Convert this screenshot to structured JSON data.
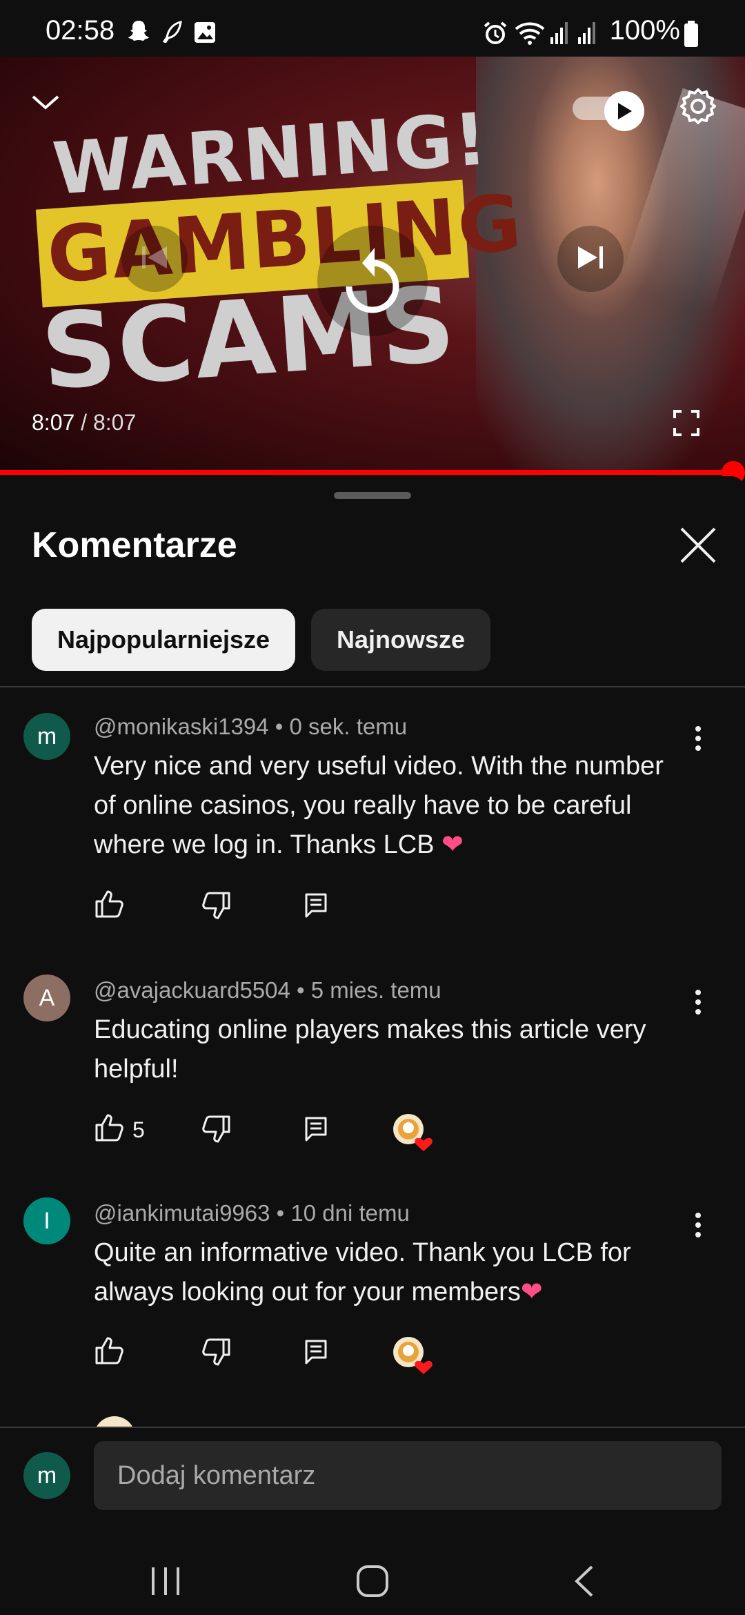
{
  "status_bar": {
    "time": "02:58",
    "battery": "100%",
    "icons": [
      "snapchat-icon",
      "feather-icon",
      "gallery-icon",
      "alarm-icon",
      "wifi-icon",
      "signal-icon",
      "battery-icon"
    ]
  },
  "video": {
    "thumbnail_lines": [
      "WARNING!",
      "GAMBLING",
      "SCAMS"
    ],
    "current_time": "8:07",
    "separator": " / ",
    "duration": "8:07",
    "progress": 1.0,
    "autoplay_on": true,
    "accent_color": "#ff0000"
  },
  "comments": {
    "title": "Komentarze",
    "chips": [
      {
        "label": "Najpopularniejsze",
        "selected": true
      },
      {
        "label": "Najnowsze",
        "selected": false
      }
    ],
    "items": [
      {
        "avatar_letter": "m",
        "avatar_color": "#0f5a4a",
        "author": "@monikaski1394",
        "time": "0 sek. temu",
        "lines": [
          "Very nice and very useful video. With the number",
          "of online casinos, you really have to be careful",
          "where we log in. Thanks LCB"
        ],
        "emoji": "❤",
        "likes": "",
        "creator_heart": false
      },
      {
        "avatar_letter": "A",
        "avatar_color": "#8d6e63",
        "author": "@avajackuard5504",
        "time": "5 mies. temu",
        "lines": [
          "Educating online players makes this article very",
          "helpful!"
        ],
        "emoji": "",
        "likes": "5",
        "creator_heart": true
      },
      {
        "avatar_letter": "I",
        "avatar_color": "#00897b",
        "author": "@iankimutai9963",
        "time": "10 dni temu",
        "lines": [
          "Quite an informative video. Thank you LCB for",
          "always looking out for your members"
        ],
        "emoji": "❤",
        "likes": "",
        "creator_heart": true
      }
    ],
    "meta_separator": " • "
  },
  "input": {
    "avatar_letter": "m",
    "avatar_color": "#0f5a4a",
    "placeholder": "Dodaj komentarz"
  }
}
